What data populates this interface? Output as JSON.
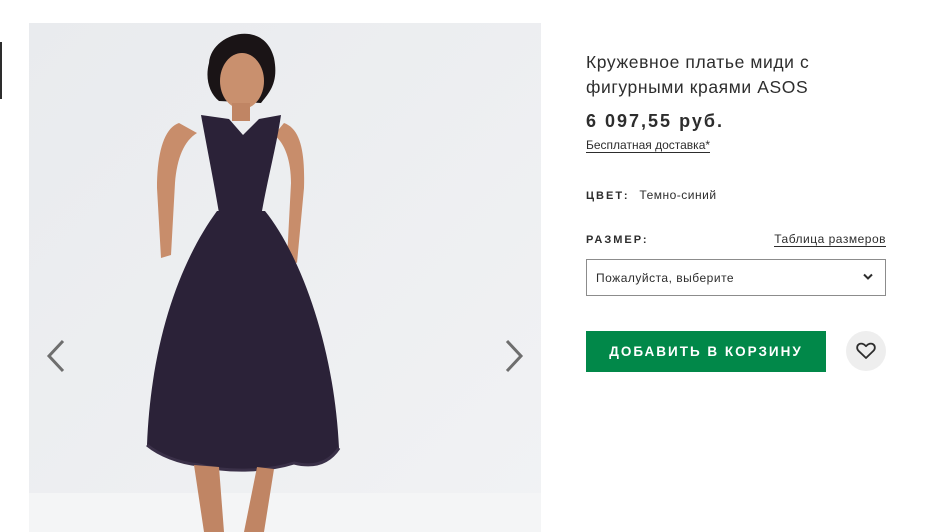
{
  "product": {
    "title": "Кружевное платье миди с фигурными краями ASOS",
    "price": "6 097,55 руб.",
    "delivery": "Бесплатная доставка*"
  },
  "color": {
    "label": "ЦВЕТ:",
    "value": "Темно-синий"
  },
  "size": {
    "label": "РАЗМЕР:",
    "guide_link": "Таблица размеров",
    "placeholder": "Пожалуйста, выберите"
  },
  "actions": {
    "add_to_bag": "ДОБАВИТЬ В КОРЗИНУ"
  },
  "icons": {
    "prev": "chevron-left-icon",
    "next": "chevron-right-icon",
    "dropdown": "chevron-down-icon",
    "favourite": "heart-icon"
  },
  "colors": {
    "accent": "#018849",
    "text": "#2d2d2d",
    "dress": "#2b2238"
  }
}
